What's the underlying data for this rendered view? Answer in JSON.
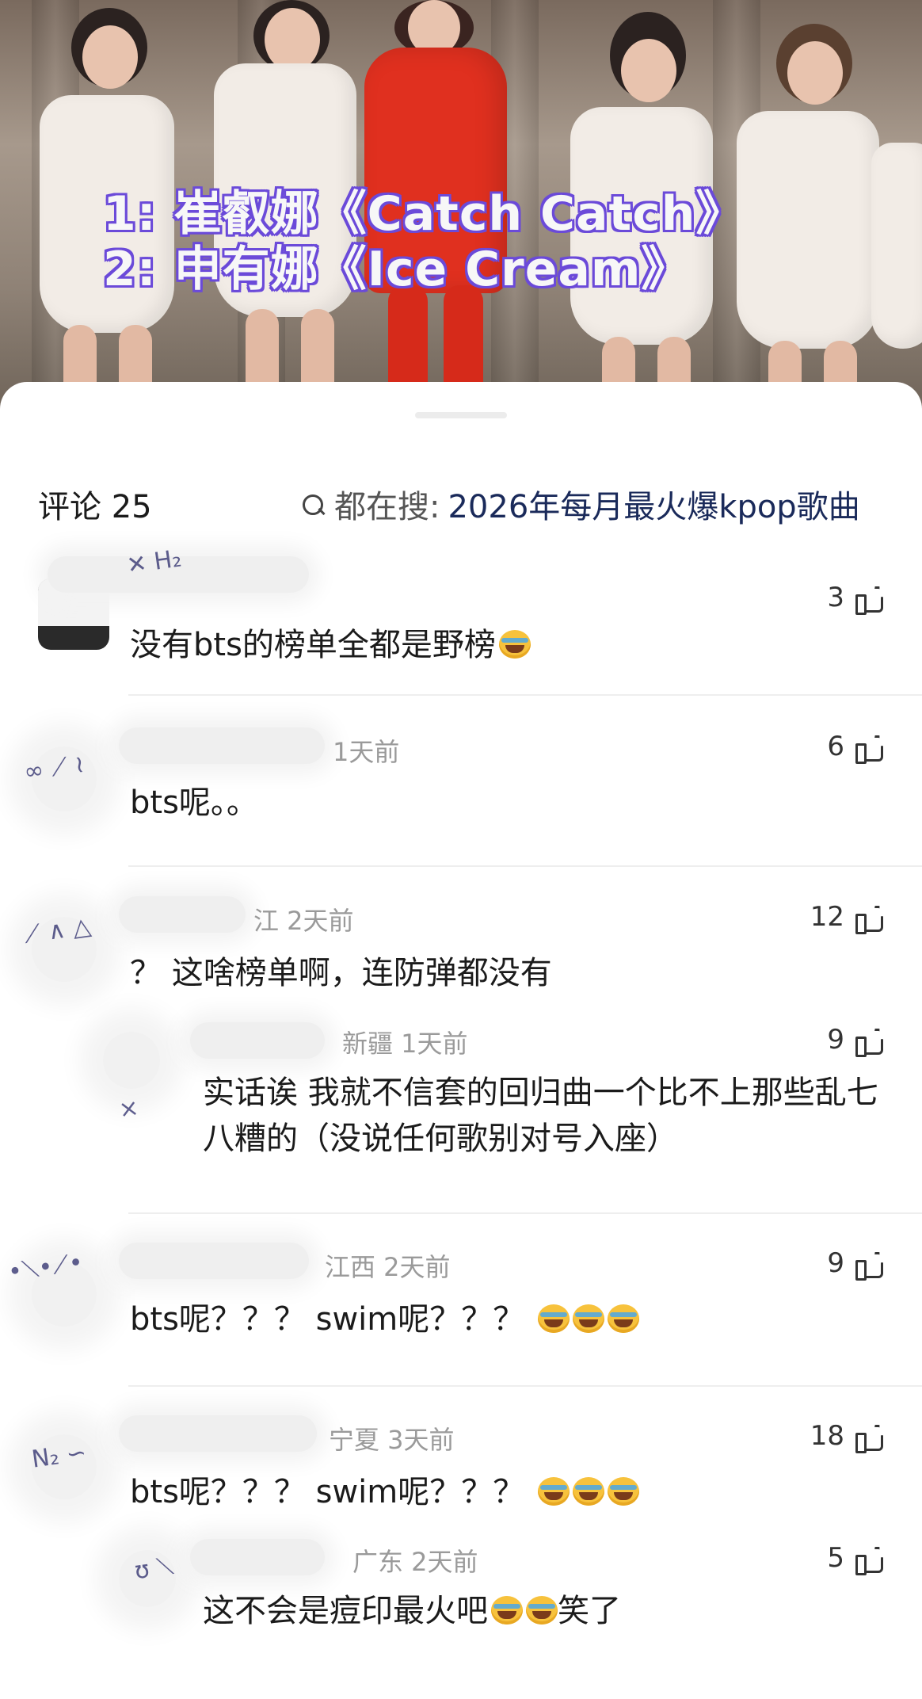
{
  "video": {
    "overlay_line1": "1:  崔叡娜《Catch Catch》",
    "overlay_line2": "2:  申有娜《Ice Cream》"
  },
  "comments_header": {
    "count_label": "评论 25",
    "search_prefix": "都在搜:",
    "search_query": "2026年每月最火爆kpop歌曲"
  },
  "comments": [
    {
      "meta": "",
      "text": "没有bts的榜单全都是野榜",
      "emoji_count": 1,
      "likes": "3",
      "reply": false
    },
    {
      "meta": "1天前",
      "text": "bts呢。。",
      "emoji_count": 0,
      "likes": "6",
      "reply": false
    },
    {
      "meta": "江 2天前",
      "text": "？ 这啥榜单啊，连防弹都没有",
      "emoji_count": 0,
      "likes": "12",
      "reply": false
    },
    {
      "meta": "新疆 1天前",
      "text": "实话诶 我就不信套的回归曲一个比不上那些乱七八糟的（没说任何歌别对号入座）",
      "emoji_count": 0,
      "likes": "9",
      "reply": true
    },
    {
      "meta": "江西 2天前",
      "text": "bts呢？？？ swim呢？？？ ",
      "emoji_count": 3,
      "likes": "9",
      "reply": false
    },
    {
      "meta": "宁夏 3天前",
      "text": "bts呢？？？ swim呢？？？ ",
      "emoji_count": 3,
      "likes": "18",
      "reply": false
    },
    {
      "meta": "广东 2天前",
      "text_before": "这不会是痘印最火吧",
      "text_after": "笑了",
      "emoji_count": 2,
      "likes": "5",
      "reply": true
    }
  ],
  "icons": {
    "like": "thumbs-up-icon",
    "search": "search-icon",
    "emoji": "tears-of-joy-emoji"
  },
  "colors": {
    "overlay_outline": "#6b4ad9",
    "search_query": "#1a2a5a",
    "meta_text": "#9a9a9a"
  }
}
